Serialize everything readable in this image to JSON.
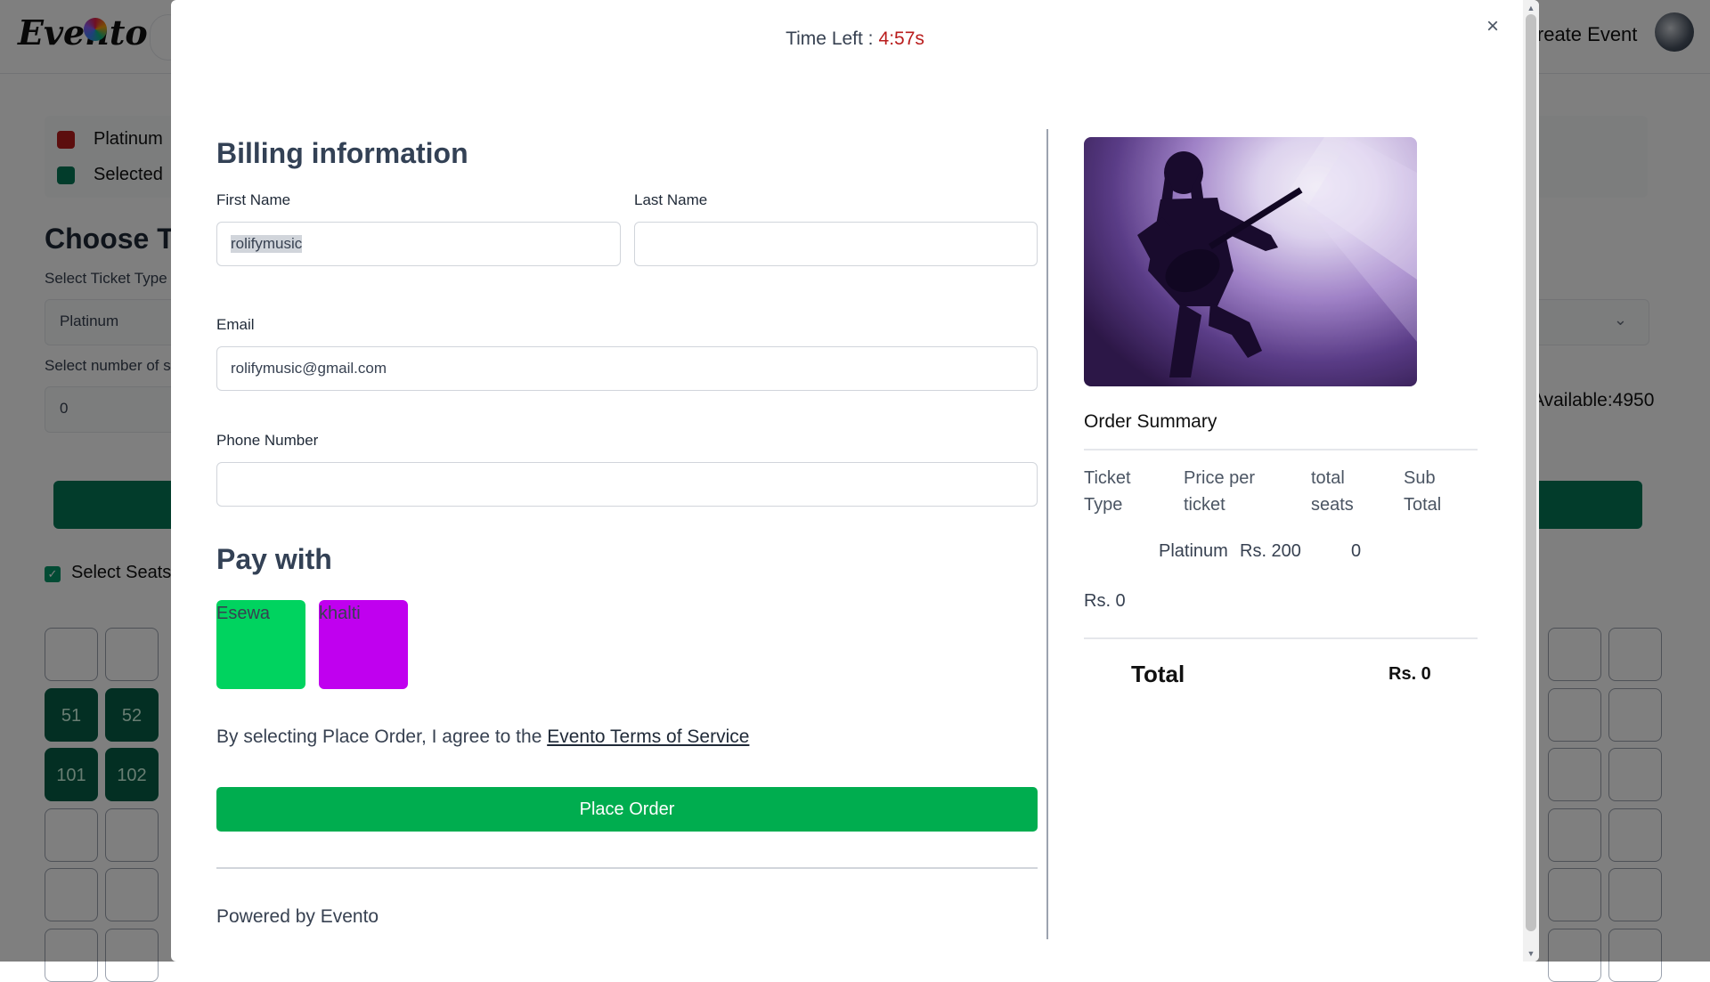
{
  "header": {
    "logo": "Evento",
    "create_event": "Create Event"
  },
  "legend": [
    {
      "label": "Platinum",
      "color": "#b91c1c"
    },
    {
      "label": "Selected",
      "color": "#047857"
    }
  ],
  "ticket_section": {
    "title": "Choose Tickets",
    "ticket_type_label": "Select Ticket Type",
    "ticket_type_value": "Platinum",
    "number_label": "Select number of seats",
    "number_value": "0",
    "available": "Available:4950",
    "select_seats_label": "Select Seats"
  },
  "seats": {
    "row2": [
      "51",
      "52"
    ],
    "row3": [
      "101",
      "102"
    ]
  },
  "modal": {
    "timer_label": "Time Left :",
    "timer_value": "4:57s",
    "billing_title": "Billing information",
    "first_name_label": "First Name",
    "first_name_value": "rolifymusic",
    "last_name_label": "Last Name",
    "last_name_value": "",
    "email_label": "Email",
    "email_value": "rolifymusic@gmail.com",
    "phone_label": "Phone Number",
    "phone_value": "",
    "pay_title": "Pay with",
    "pay_options": [
      {
        "label": "Esewa",
        "color": "#00d35f"
      },
      {
        "label": "khalti",
        "color": "#c000ef"
      }
    ],
    "terms_text": "By selecting Place Order, I agree to the ",
    "terms_link": "Evento Terms of Service",
    "place_order": "Place Order",
    "powered_by": "Powered by Evento"
  },
  "order_summary": {
    "title": "Order Summary",
    "headers": [
      "Ticket Type",
      "Price per ticket",
      "total seats",
      "Sub Total"
    ],
    "row": {
      "ticket_type": "Platinum",
      "price": "Rs. 200",
      "seats": "0",
      "subtotal": "Rs. 0"
    },
    "total_label": "Total",
    "total_value": "Rs. 0"
  }
}
